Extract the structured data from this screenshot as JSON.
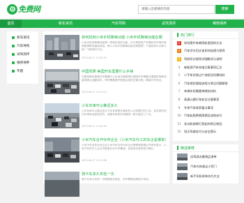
{
  "header": {
    "logo_text": "免费网",
    "search_placeholder": "请输入您想要的内容",
    "search_button": "搜索"
  },
  "nav": {
    "items": [
      "首页",
      "新车资讯",
      "汽车导购",
      "试驾测评",
      "维修保养"
    ]
  },
  "sidebar": {
    "items": [
      "新车资讯",
      "汽车导购",
      "试驾测评",
      "维修保养",
      "专题"
    ]
  },
  "articles": [
    {
      "title": "如何找到小米手机降噪功能 小米手机降噪功能在哪",
      "desc": "小米手机的降噪功能是一项很实用的功能，可以帮助用户在嘈杂的环境中获得更清晰的通话体验。那么小米手机降噪功能在哪里呢？下面就来为大家介绍一下具体的方法。",
      "date": "2023-08-17 12:55:41"
    },
    {
      "title": "中国驾照 美国开车需要什么手续",
      "desc": "中国驾照在美国开车需要什么手续中国驾照在美国开车需要办理国际驾照或者驾照公证翻译件，同时需要遵守美国当地的交通法规，确保行车安全。",
      "date": "2023-08-17 12:23:11"
    },
    {
      "title": "小车年审可以推迟多久",
      "desc": "小车年审可以推迟多久汽车年审是车辆所有人必须履行的义务，若未按时进行年审将会受到处罚，逾期年审的时间期限一般不超过三个月。",
      "date": "2023-08-17 11:42:09"
    },
    {
      "title": "小米汽车合作伙伴企业（小米汽车代工的车企是哪家）",
      "desc": "小米汽车合作伙伴企业小米汽车合作伙伴企业是哪家根据公开资料显示，小米汽车的代工企业可能是北京汽车集团，目前尚未得到官方确认。",
      "date": "2023-08-17 11:10:36"
    },
    {
      "title": "骑卡车多久年检一次",
      "desc": "骑卡车多久年检一次根据相关规定，货车需要定期进行年检。",
      "date": "2023-08-17 10:31:52"
    }
  ],
  "hot": {
    "title": "热门排行",
    "items": [
      "如何提升车辆续航里程的方法",
      "汽车涉水后应该如何处理与保养",
      "驾照扣分规则详细解读与说明",
      "新能源汽车充电注意事项汇总",
      "二手车交易过户流程及所需材料",
      "汽车保险理赔流程与常见问题解答",
      "车辆年检需要带哪些材料",
      "高速公路行车安全注意事项",
      "冬季汽车保养重点事项",
      "汽车轮胎更换周期及选购技巧",
      "发动机故障灯亮起的常见原因",
      "雨天驾驶技巧与安全提示"
    ]
  },
  "recommend": {
    "title": "精选推荐",
    "items": [
      "自驾游必备物品清单",
      "汽车内饰清洁小窍门",
      "新手司机停车技巧大全",
      "汽车空调异味处理方法"
    ]
  }
}
